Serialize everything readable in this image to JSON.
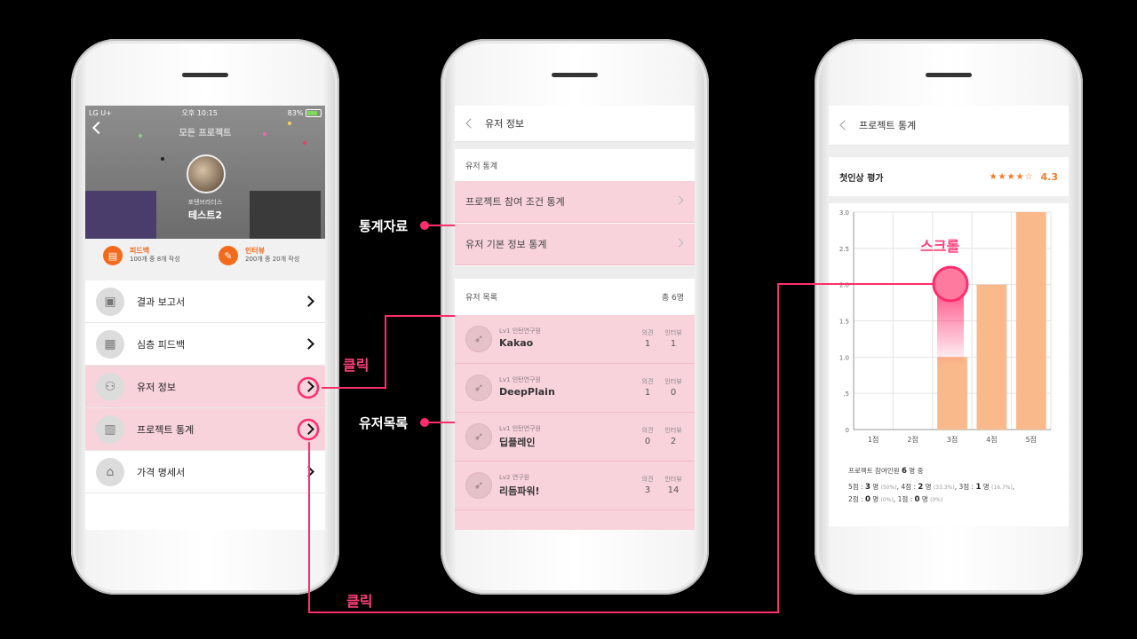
{
  "phone1": {
    "status": {
      "carrier": "LG U+",
      "time": "오후 10:15",
      "battery": "83%"
    },
    "header_title": "모든 프로젝트",
    "org": "포텐브라더스",
    "username": "테스트2",
    "feedback": {
      "label": "피드백",
      "desc": "100개 중 8개 작성"
    },
    "interview": {
      "label": "인터뷰",
      "desc": "200개 중 20개 작성"
    },
    "menu": [
      {
        "label": "결과 보고서",
        "icon": "report-icon"
      },
      {
        "label": "심층 피드백",
        "icon": "feedback-icon"
      },
      {
        "label": "유저 정보",
        "icon": "users-icon"
      },
      {
        "label": "프로젝트 통계",
        "icon": "chart-icon"
      },
      {
        "label": "가격 명세서",
        "icon": "price-tag-icon"
      }
    ]
  },
  "phone2": {
    "nav_title": "유저 정보",
    "stats_section": "유저 통계",
    "stats_links": [
      "프로젝트 참여 조건 통계",
      "유저 기본 정보 통계"
    ],
    "list_section": "유저 목록",
    "list_count": "총 6명",
    "col_opinion": "의견",
    "col_interview": "인터뷰",
    "users": [
      {
        "level": "Lv1 인턴연구원",
        "name": "Kakao",
        "opinion": "1",
        "interview": "1"
      },
      {
        "level": "Lv1 인턴연구원",
        "name": "DeepPlain",
        "opinion": "1",
        "interview": "0"
      },
      {
        "level": "Lv1 인턴연구원",
        "name": "딥플레인",
        "opinion": "0",
        "interview": "2"
      },
      {
        "level": "Lv2 연구원",
        "name": "리듬파워!",
        "opinion": "3",
        "interview": "14"
      }
    ]
  },
  "phone3": {
    "nav_title": "프로젝트 통계",
    "rating_label": "첫인상 평가",
    "rating_stars": "★★★★☆",
    "rating_score": "4.3",
    "summary_head": "프로젝트 참여인원",
    "summary_count": "6",
    "summary_unit": "명 중",
    "summary_items": [
      {
        "label": "5점",
        "count": "3",
        "pct": "(50%)"
      },
      {
        "label": "4점",
        "count": "2",
        "pct": "(33.3%)"
      },
      {
        "label": "3점",
        "count": "1",
        "pct": "(16.7%)"
      },
      {
        "label": "2점",
        "count": "0",
        "pct": "(0%)"
      },
      {
        "label": "1점",
        "count": "0",
        "pct": "(0%)"
      }
    ],
    "unit": "명"
  },
  "chart_data": {
    "type": "bar",
    "categories": [
      "1점",
      "2점",
      "3점",
      "4점",
      "5점"
    ],
    "values": [
      0,
      0,
      1,
      2,
      3
    ],
    "ylim": [
      0,
      3
    ],
    "yticks": [
      "0",
      ".5",
      "1.0",
      "1.5",
      "2.0",
      "2.5",
      "3.0"
    ],
    "bar_color": "#f9b98a",
    "grid": true
  },
  "annotations": {
    "stats_data": "통계자료",
    "user_list": "유저목록",
    "click1": "클릭",
    "click2": "클릭",
    "scroll": "스크롤"
  },
  "colors": {
    "accent": "#ff2d6e",
    "highlight": "#f9d3dc",
    "orange": "#f26b1d"
  }
}
